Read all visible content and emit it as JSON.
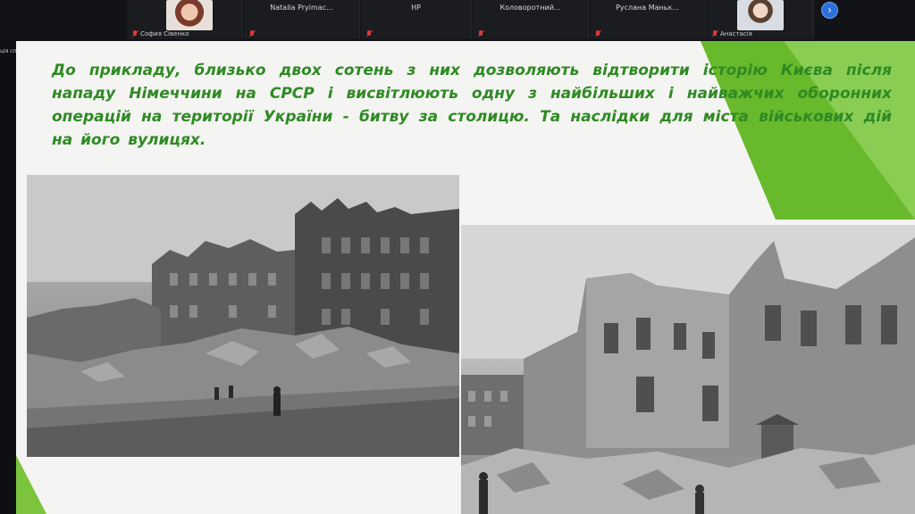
{
  "participants": [
    {
      "id": "p1",
      "name": "София Сівенко",
      "has_video": true,
      "muted": true
    },
    {
      "id": "p2",
      "name": "Natalia Pryimac...",
      "muted": true
    },
    {
      "id": "p3",
      "name": "HP",
      "muted": true
    },
    {
      "id": "p4",
      "name": "Коловоротний...",
      "muted": true
    },
    {
      "id": "p5",
      "name": "Руслана Маньк...",
      "muted": true
    },
    {
      "id": "p6",
      "name": "Анастасія",
      "has_video": true,
      "muted": true
    }
  ],
  "nav": {
    "next_icon": "chevron-right-icon",
    "next_glyph": "›"
  },
  "side_label": "ція спіль",
  "slide": {
    "text": "До прикладу, близько двох сотень  з них дозволяють відтворити історію Києва після нападу Німеччини на СРСР і висвітлюють одну з найбільших і найважчих оборонних операцій на території України - битву за  столицю. Та наслідки для міста військових дій на його вулицях.",
    "accent_color": "#69b92c",
    "text_color": "#2f8a24",
    "photos": [
      {
        "id": "photo-1",
        "type": "black-and-white",
        "subject": "ruined city street"
      },
      {
        "id": "photo-2",
        "type": "black-and-white",
        "subject": "ruined buildings"
      }
    ]
  }
}
